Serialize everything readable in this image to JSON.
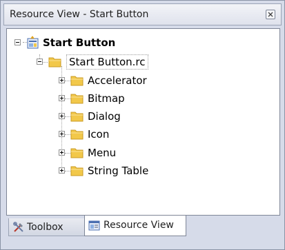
{
  "panel": {
    "title": "Resource View - Start Button",
    "close_icon": "close-icon"
  },
  "tree": {
    "root": {
      "label": "Start Button",
      "icon": "project-icon",
      "expanded": true
    },
    "rc_file": {
      "label": "Start Button.rc",
      "icon": "folder-icon",
      "expanded": true
    },
    "items": [
      {
        "label": "Accelerator",
        "icon": "folder-icon"
      },
      {
        "label": "Bitmap",
        "icon": "folder-icon"
      },
      {
        "label": "Dialog",
        "icon": "folder-icon"
      },
      {
        "label": "Icon",
        "icon": "folder-icon"
      },
      {
        "label": "Menu",
        "icon": "folder-icon"
      },
      {
        "label": "String Table",
        "icon": "folder-icon"
      }
    ]
  },
  "tabs": [
    {
      "label": "Toolbox",
      "icon": "toolbox-icon",
      "active": false
    },
    {
      "label": "Resource View",
      "icon": "resource-view-icon",
      "active": true
    }
  ],
  "colors": {
    "frame": "#d6dbe9",
    "folder": "#f2c84a",
    "border": "#7d8596"
  }
}
